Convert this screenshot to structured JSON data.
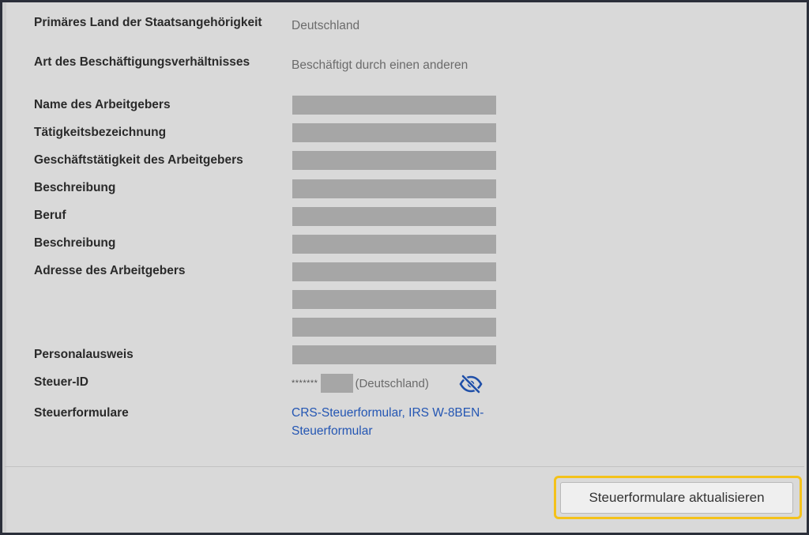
{
  "fields": {
    "citizenship": {
      "label": "Primäres Land der Staatsangehörigkeit",
      "value": "Deutschland"
    },
    "employment_type": {
      "label": "Art des Beschäftigungsverhältnisses",
      "value": "Beschäftigt durch einen anderen"
    },
    "employer_name": {
      "label": "Name des Arbeitgebers"
    },
    "job_title": {
      "label": "Tätigkeitsbezeichnung"
    },
    "employer_business": {
      "label": "Geschäftstätigkeit des Arbeitgebers"
    },
    "description_1": {
      "label": "Beschreibung"
    },
    "occupation": {
      "label": "Beruf"
    },
    "description_2": {
      "label": "Beschreibung"
    },
    "employer_address": {
      "label": "Adresse des Arbeitgebers"
    },
    "id_card": {
      "label": "Personalausweis"
    },
    "tax_id": {
      "label": "Steuer-ID",
      "masked_prefix": "*******",
      "country": "(Deutschland)",
      "toggle_icon": "eye-slash-icon"
    },
    "tax_forms": {
      "label": "Steuerformulare",
      "link_text": "CRS-Steuerformular, IRS W-8BEN-Steuerformular"
    }
  },
  "footer": {
    "update_button_label": "Steuerformulare aktualisieren"
  },
  "colors": {
    "link": "#2456b3",
    "highlight": "#f4c21a",
    "redaction": "#a6a6a6",
    "background": "#d9d9d9"
  }
}
